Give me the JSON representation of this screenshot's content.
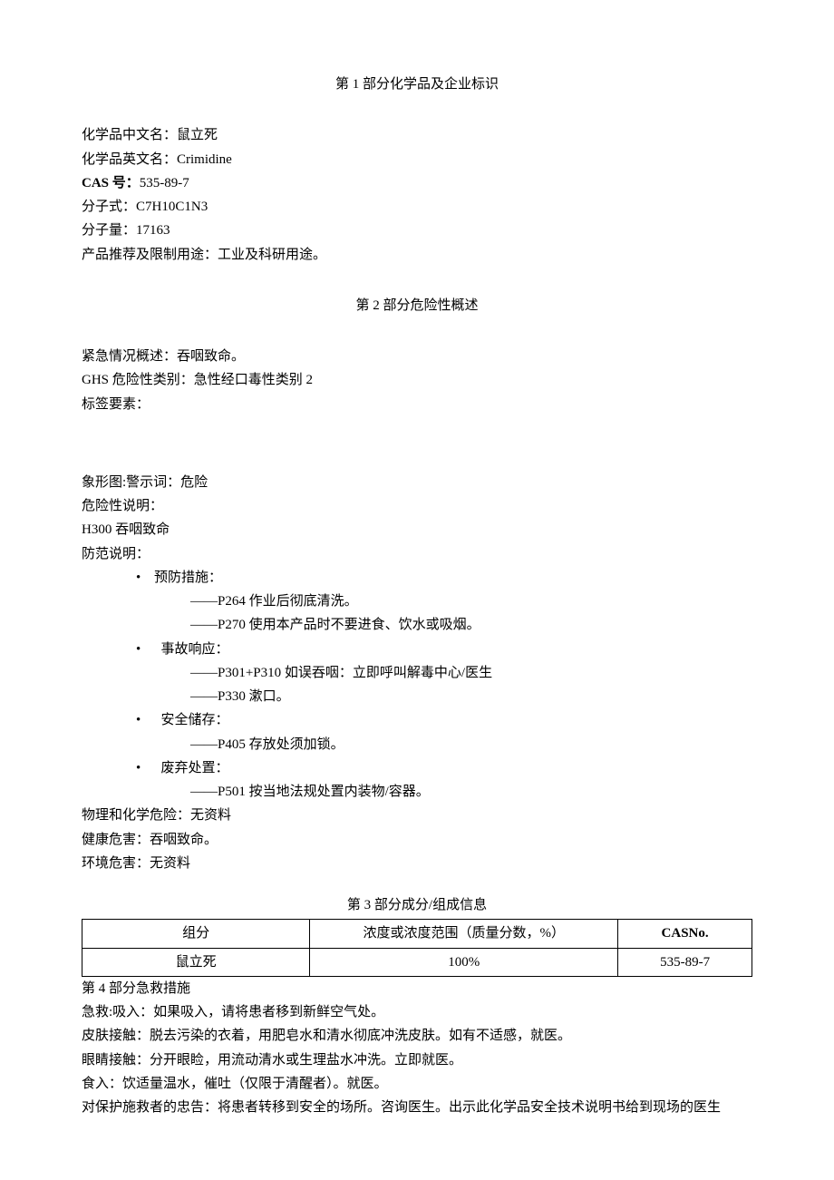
{
  "section1": {
    "title": "第 1 部分化学品及企业标识",
    "name_cn_label": "化学品中文名：",
    "name_cn_value": "鼠立死",
    "name_en_label": "化学品英文名：",
    "name_en_value": "Crimidine",
    "cas_label": "CAS 号：",
    "cas_value": "535-89-7",
    "formula_label": "分子式：",
    "formula_value": "C7H10C1N3",
    "mw_label": "分子量：",
    "mw_value": "17163",
    "use_label": "产品推荐及限制用途：",
    "use_value": "工业及科研用途。"
  },
  "section2": {
    "title": "第 2 部分危险性概述",
    "emergency_label": "紧急情况概述：",
    "emergency_value": "吞咽致命。",
    "ghs_label": "GHS 危险性类别：",
    "ghs_value": "急性经口毒性类别 2",
    "label_elements": "标签要素：",
    "pictogram": "象形图:警示词：危险",
    "hazard_stmt_label": "危险性说明：",
    "hazard_h300": "H300 吞咽致命",
    "precaution_label": "防范说明：",
    "prevention": {
      "title": "预防措施：",
      "p264": "——P264 作业后彻底清洗。",
      "p270": "——P270 使用本产品时不要进食、饮水或吸烟。"
    },
    "response": {
      "title": "事故响应：",
      "p301": "——P301+P310 如误吞咽：立即呼叫解毒中心/医生",
      "p330": "——P330 漱口。"
    },
    "storage": {
      "title": "安全储存：",
      "p405": "——P405 存放处须加锁。"
    },
    "disposal": {
      "title": "废弃处置：",
      "p501": "——P501 按当地法规处置内装物/容器。"
    },
    "phys_chem_label": "物理和化学危险：",
    "phys_chem_value": "无资料",
    "health_label": "健康危害：",
    "health_value": "吞咽致命。",
    "env_label": "环境危害：",
    "env_value": "无资料"
  },
  "section3": {
    "title": "第 3 部分成分/组成信息",
    "headers": {
      "component": "组分",
      "concentration": "浓度或浓度范围（质量分数，%）",
      "casno": "CASNo."
    },
    "row": {
      "component": "鼠立死",
      "concentration": "100%",
      "casno": "535-89-7"
    }
  },
  "section4": {
    "title": "第 4 部分急救措施",
    "inhalation": "急救:吸入：如果吸入，请将患者移到新鲜空气处。",
    "skin": "皮肤接触：脱去污染的衣着，用肥皂水和清水彻底冲洗皮肤。如有不适感，就医。",
    "eye": "眼睛接触：分开眼睑，用流动清水或生理盐水冲洗。立即就医。",
    "ingestion": "食入：饮适量温水，催吐（仅限于清醒者）。就医。",
    "note": "对保护施救者的忠告：将患者转移到安全的场所。咨询医生。出示此化学品安全技术说明书给到现场的医生"
  },
  "bullets": {
    "dot": "•"
  }
}
